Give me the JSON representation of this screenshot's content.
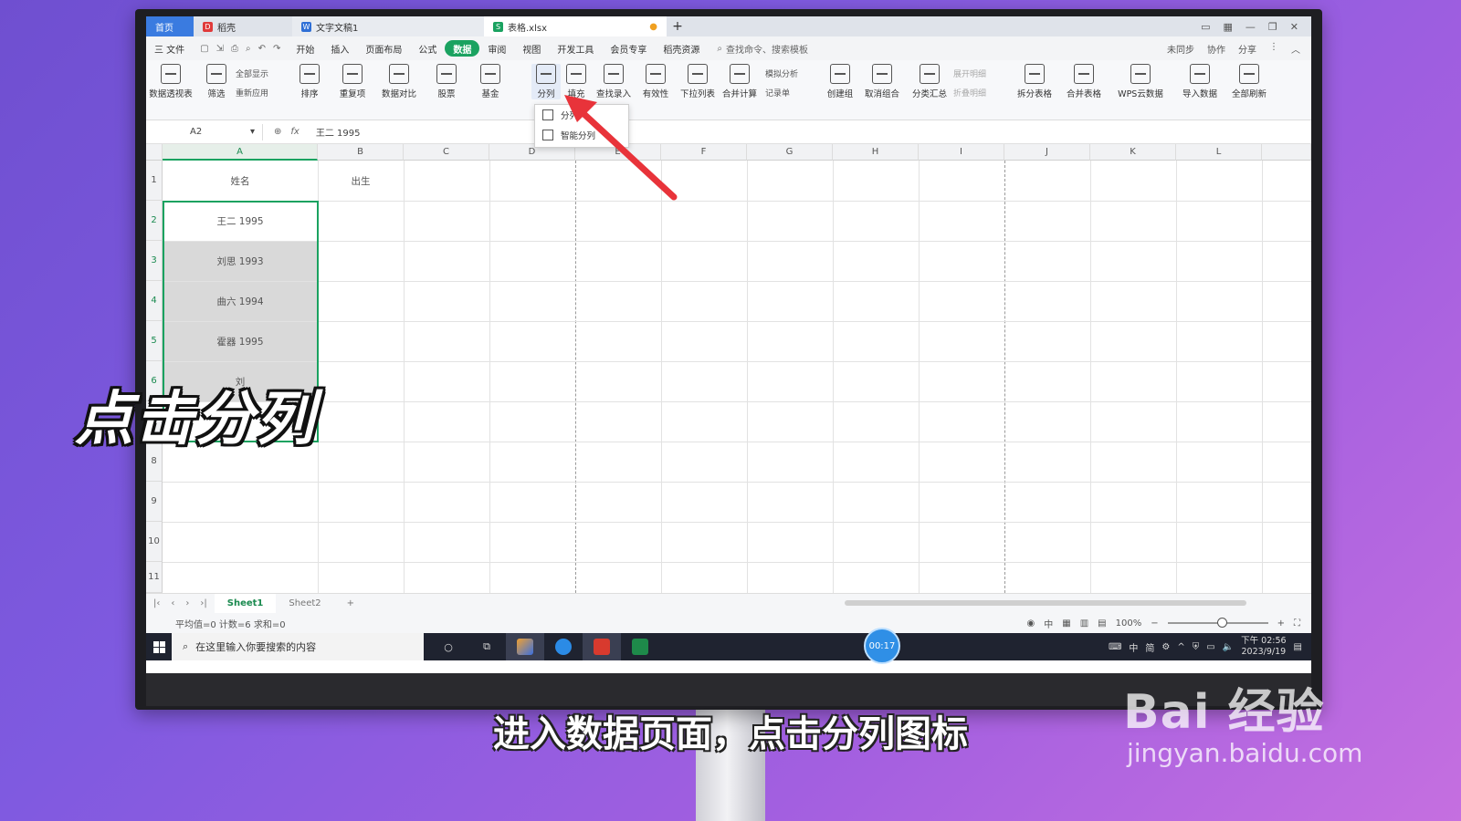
{
  "tabs": {
    "home": "首页",
    "daoke": "稻壳",
    "doc": "文字文稿1",
    "active": "表格.xlsx",
    "add": "+"
  },
  "menubar": {
    "file": "三 文件",
    "items": [
      "开始",
      "插入",
      "页面布局",
      "公式",
      "数据",
      "审阅",
      "视图",
      "开发工具",
      "会员专享",
      "稻壳资源"
    ],
    "active_item": "数据",
    "search": "查找命令、搜索模板",
    "right": [
      "未同步",
      "协作",
      "分享"
    ]
  },
  "ribbon": {
    "pivot": "数据透视表",
    "filter": "筛选",
    "show_all": "全部显示",
    "reapply": "重新应用",
    "sort": "排序",
    "dup": "重复项",
    "compare": "数据对比",
    "stock": "股票",
    "fund": "基金",
    "split": "分列",
    "fill": "填充",
    "lookup": "查找录入",
    "validity": "有效性",
    "dropdown_list": "下拉列表",
    "consolidate": "合并计算",
    "whatif": "模拟分析",
    "record": "记录单",
    "group": "创建组",
    "ungroup": "取消组合",
    "subtotal": "分类汇总",
    "expand": "展开明细",
    "collapse": "折叠明细",
    "split_table": "拆分表格",
    "merge_table": "合并表格",
    "wps_cloud": "WPS云数据",
    "import": "导入数据",
    "refresh_all": "全部刷新"
  },
  "split_dropdown": {
    "items": [
      "分列",
      "智能分列"
    ]
  },
  "formula_bar": {
    "name_box": "A2",
    "fx": "fx",
    "value": "王二   1995"
  },
  "columns": [
    "A",
    "B",
    "C",
    "D",
    "E",
    "F",
    "G",
    "H",
    "I",
    "J",
    "K",
    "L"
  ],
  "rows": [
    "1",
    "2",
    "3",
    "4",
    "5",
    "6",
    "7",
    "8",
    "9",
    "10",
    "11"
  ],
  "cells": {
    "A1": "姓名",
    "B1": "出生",
    "A2": "王二   1995",
    "A3": "刘思   1993",
    "A4": "曲六   1994",
    "A5": "霍器   1995",
    "A6": "刘"
  },
  "sheets": [
    "Sheet1",
    "Sheet2"
  ],
  "status": {
    "stats": "平均值=0  计数=6  求和=0",
    "zoom": "100%"
  },
  "timer": "00:17",
  "taskbar": {
    "search_placeholder": "在这里输入你要搜索的内容",
    "ime": "中",
    "ime_mode": "简",
    "time": "下午 02:56",
    "date": "2023/9/19"
  },
  "overlay": {
    "big_label": "点击分列",
    "subtitle": "进入数据页面，点击分列图标",
    "watermark_brand": "Bai 经验",
    "watermark_url": "jingyan.baidu.com"
  },
  "colors": {
    "accent_green": "#1aa260",
    "arrow_red": "#e8333a",
    "timer_blue": "#2f8fe6"
  }
}
